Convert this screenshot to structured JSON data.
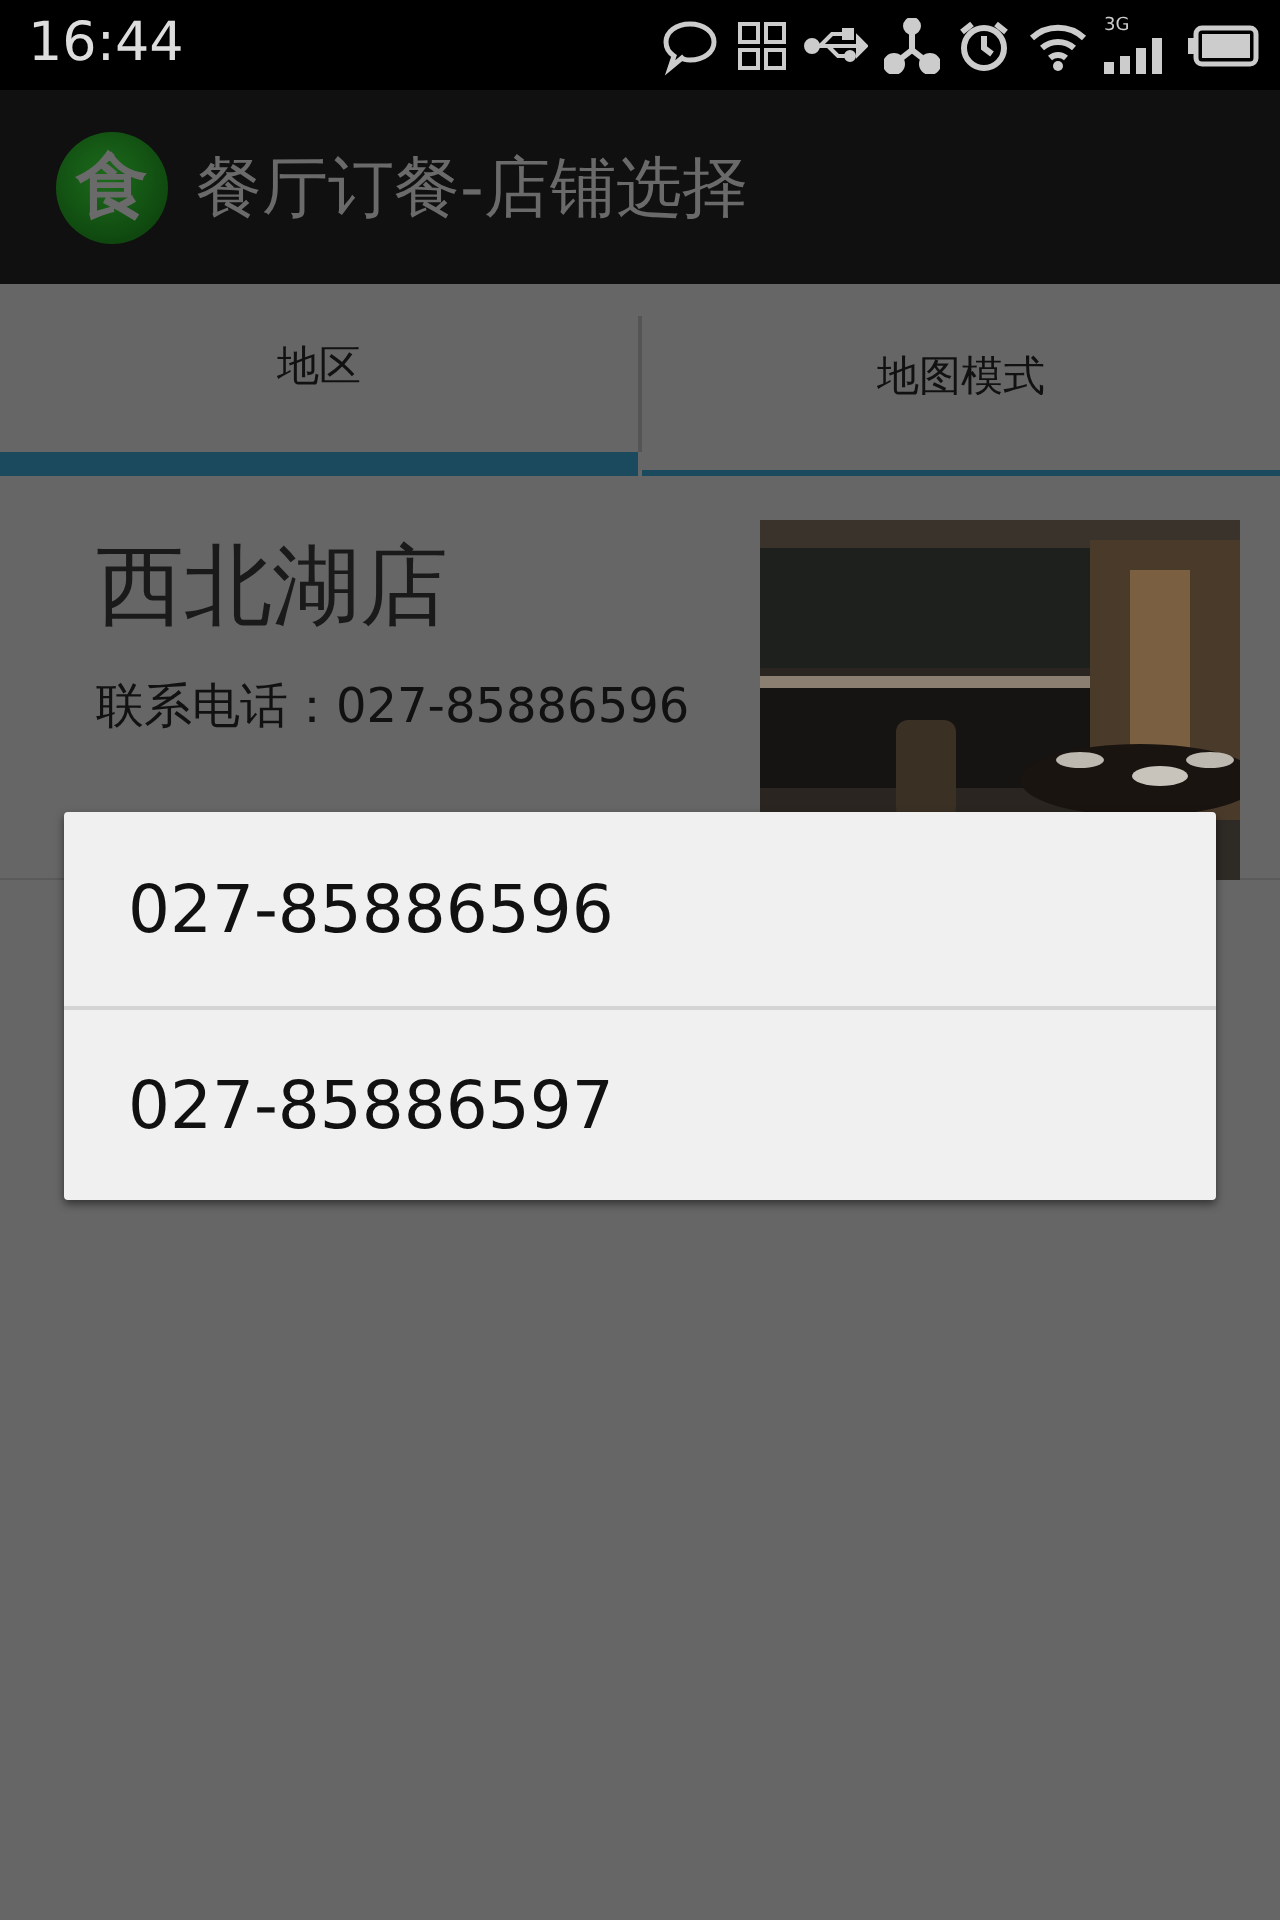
{
  "status_bar": {
    "time": "16:44",
    "network_label": "3G"
  },
  "app_bar": {
    "logo_text": "食",
    "title": "餐厅订餐-店铺选择"
  },
  "tabs": [
    {
      "label": "地区",
      "selected": true
    },
    {
      "label": "地图模式",
      "selected": false
    }
  ],
  "stores": [
    {
      "name": "西北湖店",
      "phone_label": "联系电话：027-85886596"
    }
  ],
  "phone_dialog": {
    "options": [
      "027-85886596",
      "027-85886597"
    ]
  }
}
